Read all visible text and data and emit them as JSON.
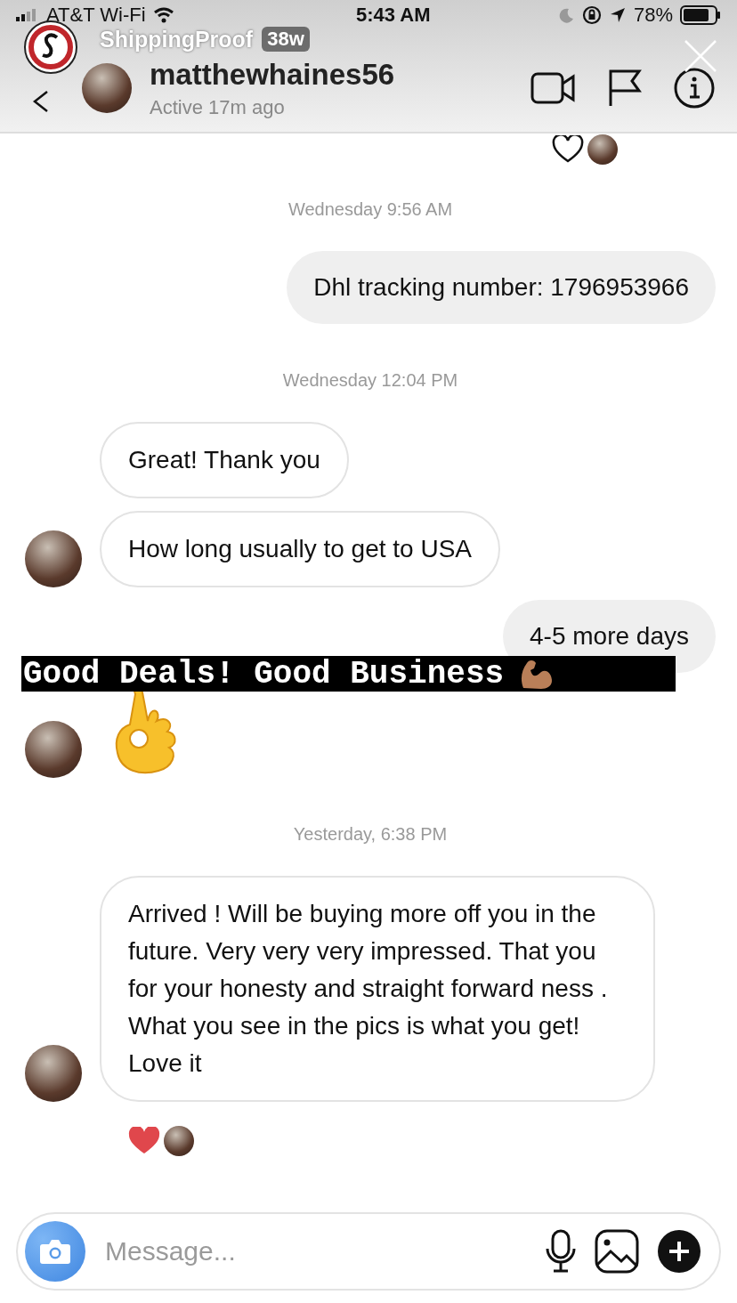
{
  "status_bar": {
    "carrier": "AT&T Wi-Fi",
    "time": "5:43 AM",
    "battery": "78%"
  },
  "story": {
    "account": "ShippingProof",
    "age": "38w"
  },
  "header": {
    "username": "matthewhaines56",
    "status": "Active 17m ago"
  },
  "messages": [
    {
      "kind": "reactions",
      "outgoing": true,
      "liked": false
    },
    {
      "kind": "time",
      "text": "Wednesday 9:56 AM"
    },
    {
      "kind": "message",
      "outgoing": true,
      "text": "Dhl tracking number: 1796953966"
    },
    {
      "kind": "time",
      "text": "Wednesday 12:04 PM"
    },
    {
      "kind": "message",
      "outgoing": false,
      "text": "Great! Thank you",
      "avatar": false
    },
    {
      "kind": "message",
      "outgoing": false,
      "text": "How long usually to get to USA",
      "avatar": true
    },
    {
      "kind": "message",
      "outgoing": true,
      "text": "4-5 more days"
    },
    {
      "kind": "emoji",
      "outgoing": false,
      "avatar": true
    },
    {
      "kind": "time",
      "text": "Yesterday, 6:38 PM"
    },
    {
      "kind": "message",
      "outgoing": false,
      "text": "Arrived ! Will be buying more off you in the future. Very very very impressed. That you for your honesty and straight forward ness . What you see in the pics is what you get! Love it",
      "avatar": true
    },
    {
      "kind": "reactions",
      "outgoing": false,
      "liked": true
    }
  ],
  "sticker": {
    "text": "Good Deals! Good Business"
  },
  "composer": {
    "placeholder": "Message..."
  }
}
